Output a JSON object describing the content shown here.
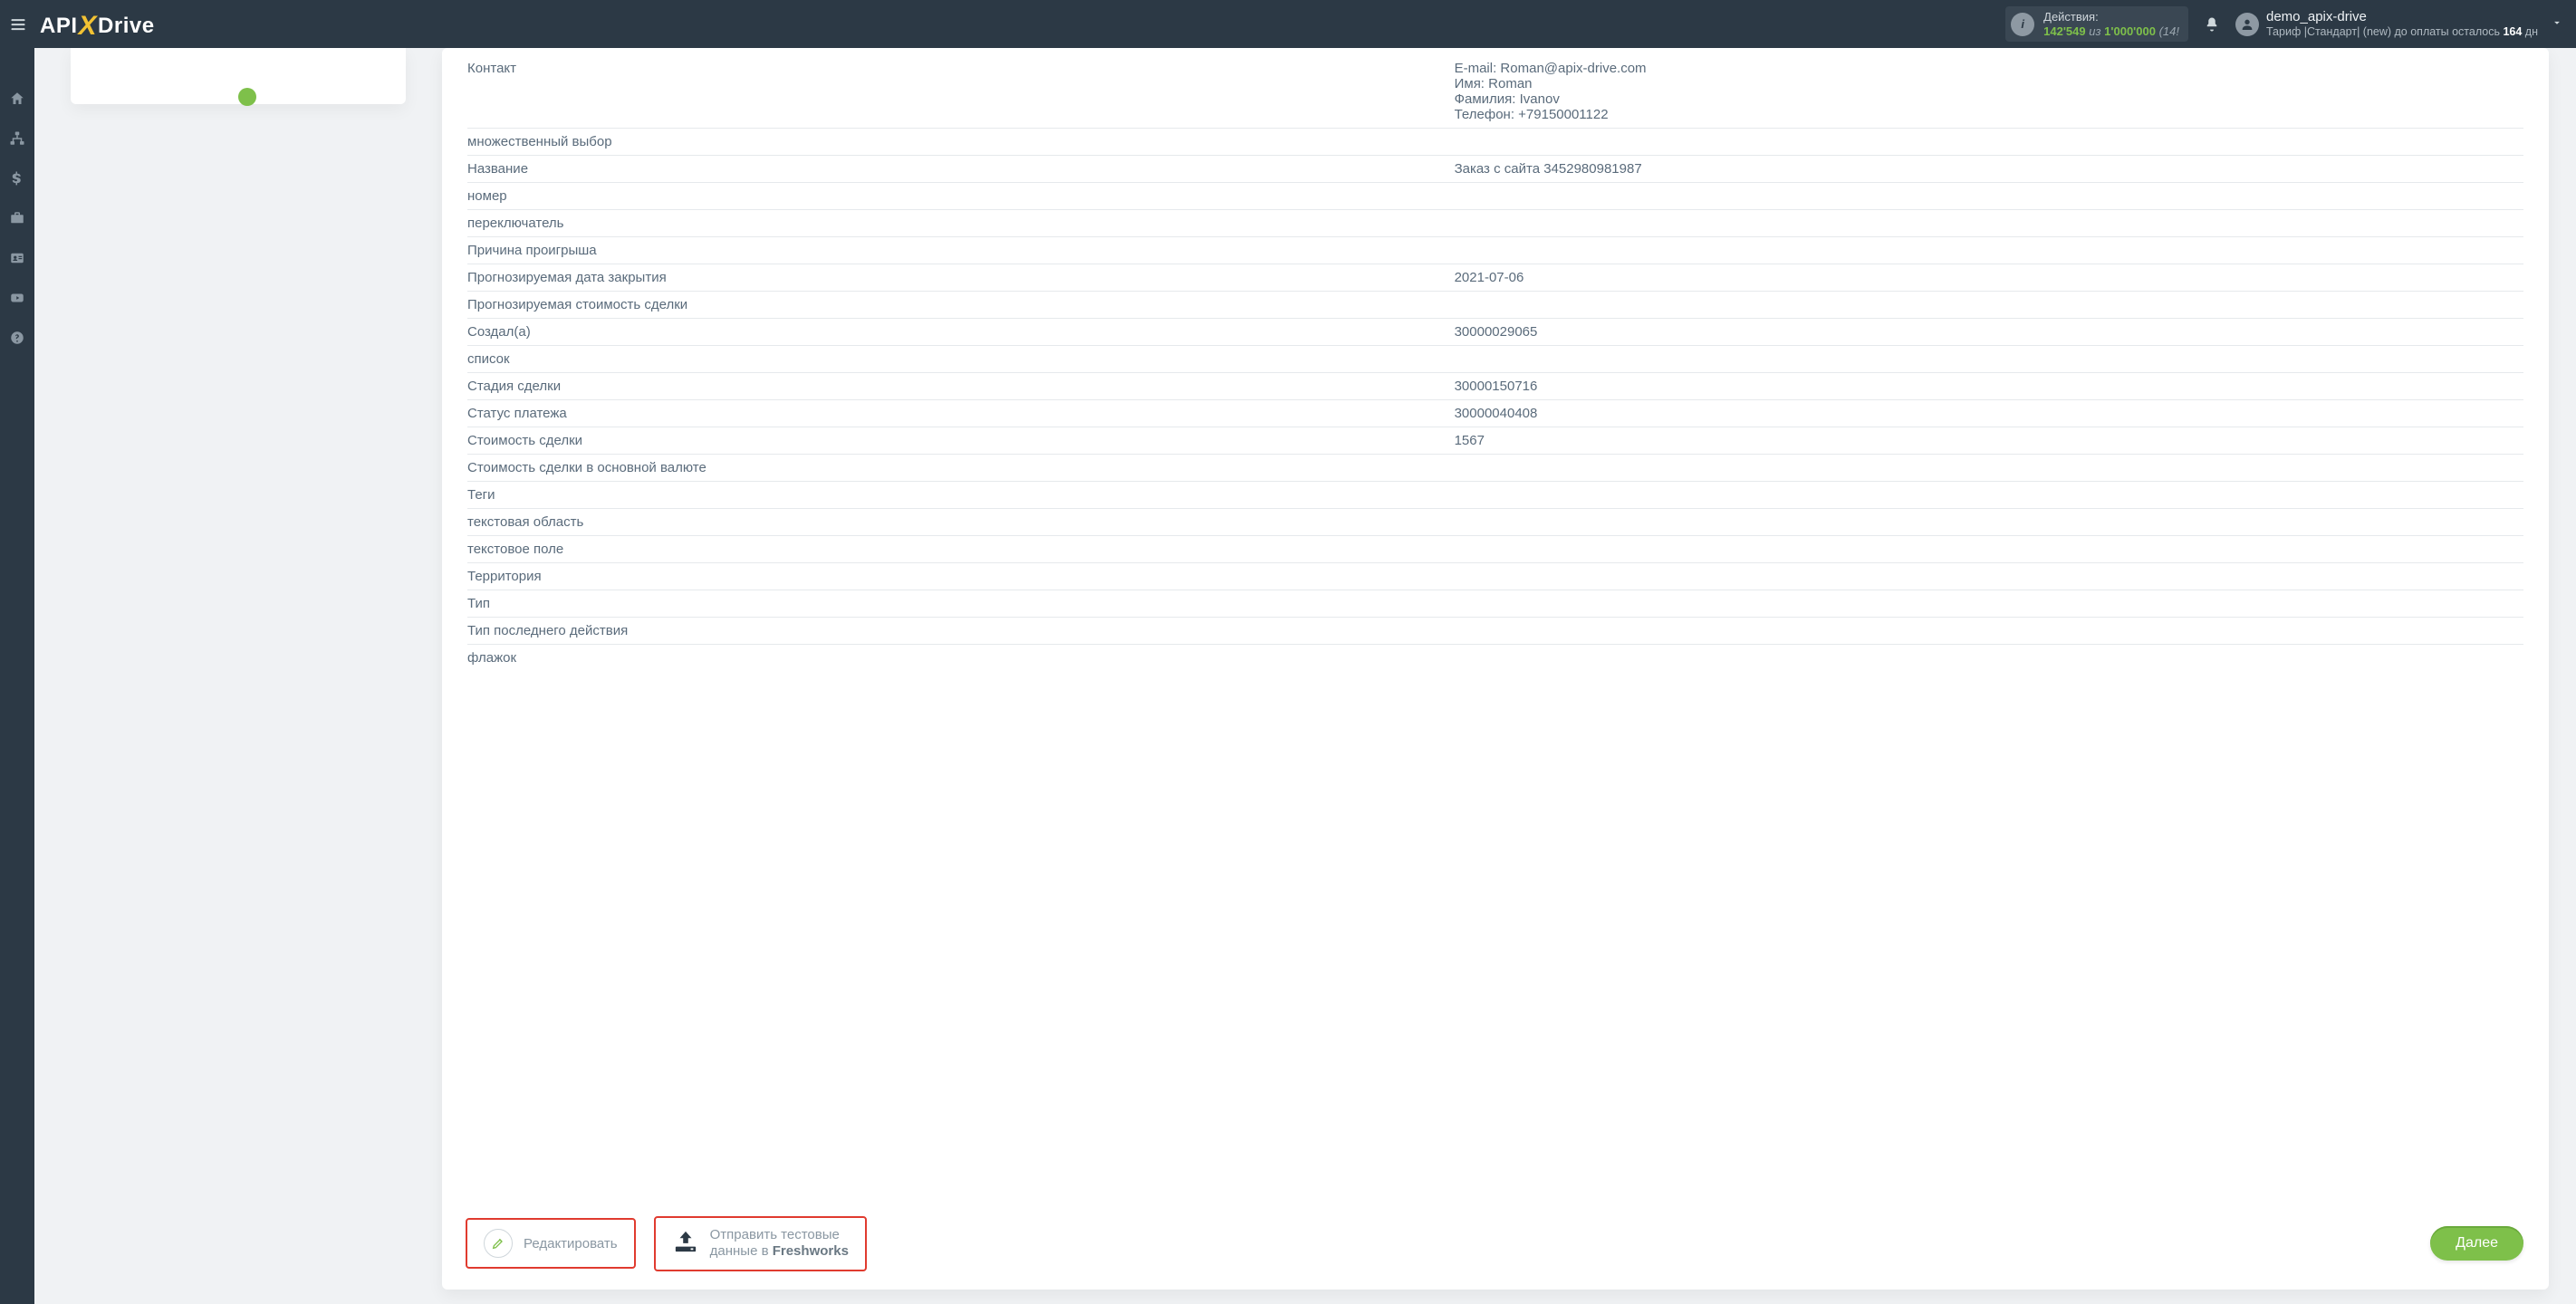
{
  "header": {
    "actions_label": "Действия:",
    "actions_used": "142'549",
    "actions_of_word": "из",
    "actions_total": "1'000'000",
    "actions_tail": "(14!",
    "user_name": "demo_apix-drive",
    "tariff_prefix": "Тариф |Стандарт| (new) до оплаты осталось ",
    "tariff_days": "164",
    "tariff_suffix": " дн"
  },
  "rows": [
    {
      "label": "Контакт",
      "values": [
        "E-mail: Roman@apix-drive.com",
        "Имя: Roman",
        "Фамилия: Ivanov",
        "Телефон: +79150001122"
      ]
    },
    {
      "label": "множественный выбор",
      "value": ""
    },
    {
      "label": "Название",
      "value": "Заказ с сайта 3452980981987"
    },
    {
      "label": "номер",
      "value": ""
    },
    {
      "label": "переключатель",
      "value": ""
    },
    {
      "label": "Причина проигрыша",
      "value": ""
    },
    {
      "label": "Прогнозируемая дата закрытия",
      "value": "2021-07-06"
    },
    {
      "label": "Прогнозируемая стоимость сделки",
      "value": ""
    },
    {
      "label": "Создал(а)",
      "value": "30000029065"
    },
    {
      "label": "список",
      "value": ""
    },
    {
      "label": "Стадия сделки",
      "value": "30000150716"
    },
    {
      "label": "Статус платежа",
      "value": "30000040408"
    },
    {
      "label": "Стоимость сделки",
      "value": "1567"
    },
    {
      "label": "Стоимость сделки в основной валюте",
      "value": ""
    },
    {
      "label": "Теги",
      "value": ""
    },
    {
      "label": "текстовая область",
      "value": ""
    },
    {
      "label": "текстовое поле",
      "value": ""
    },
    {
      "label": "Территория",
      "value": ""
    },
    {
      "label": "Тип",
      "value": ""
    },
    {
      "label": "Тип последнего действия",
      "value": ""
    },
    {
      "label": "флажок",
      "value": ""
    }
  ],
  "footer": {
    "edit_label": "Редактировать",
    "send_line1": "Отправить тестовые",
    "send_line2_prefix": "данные в ",
    "send_line2_bold": "Freshworks",
    "next_label": "Далее"
  }
}
